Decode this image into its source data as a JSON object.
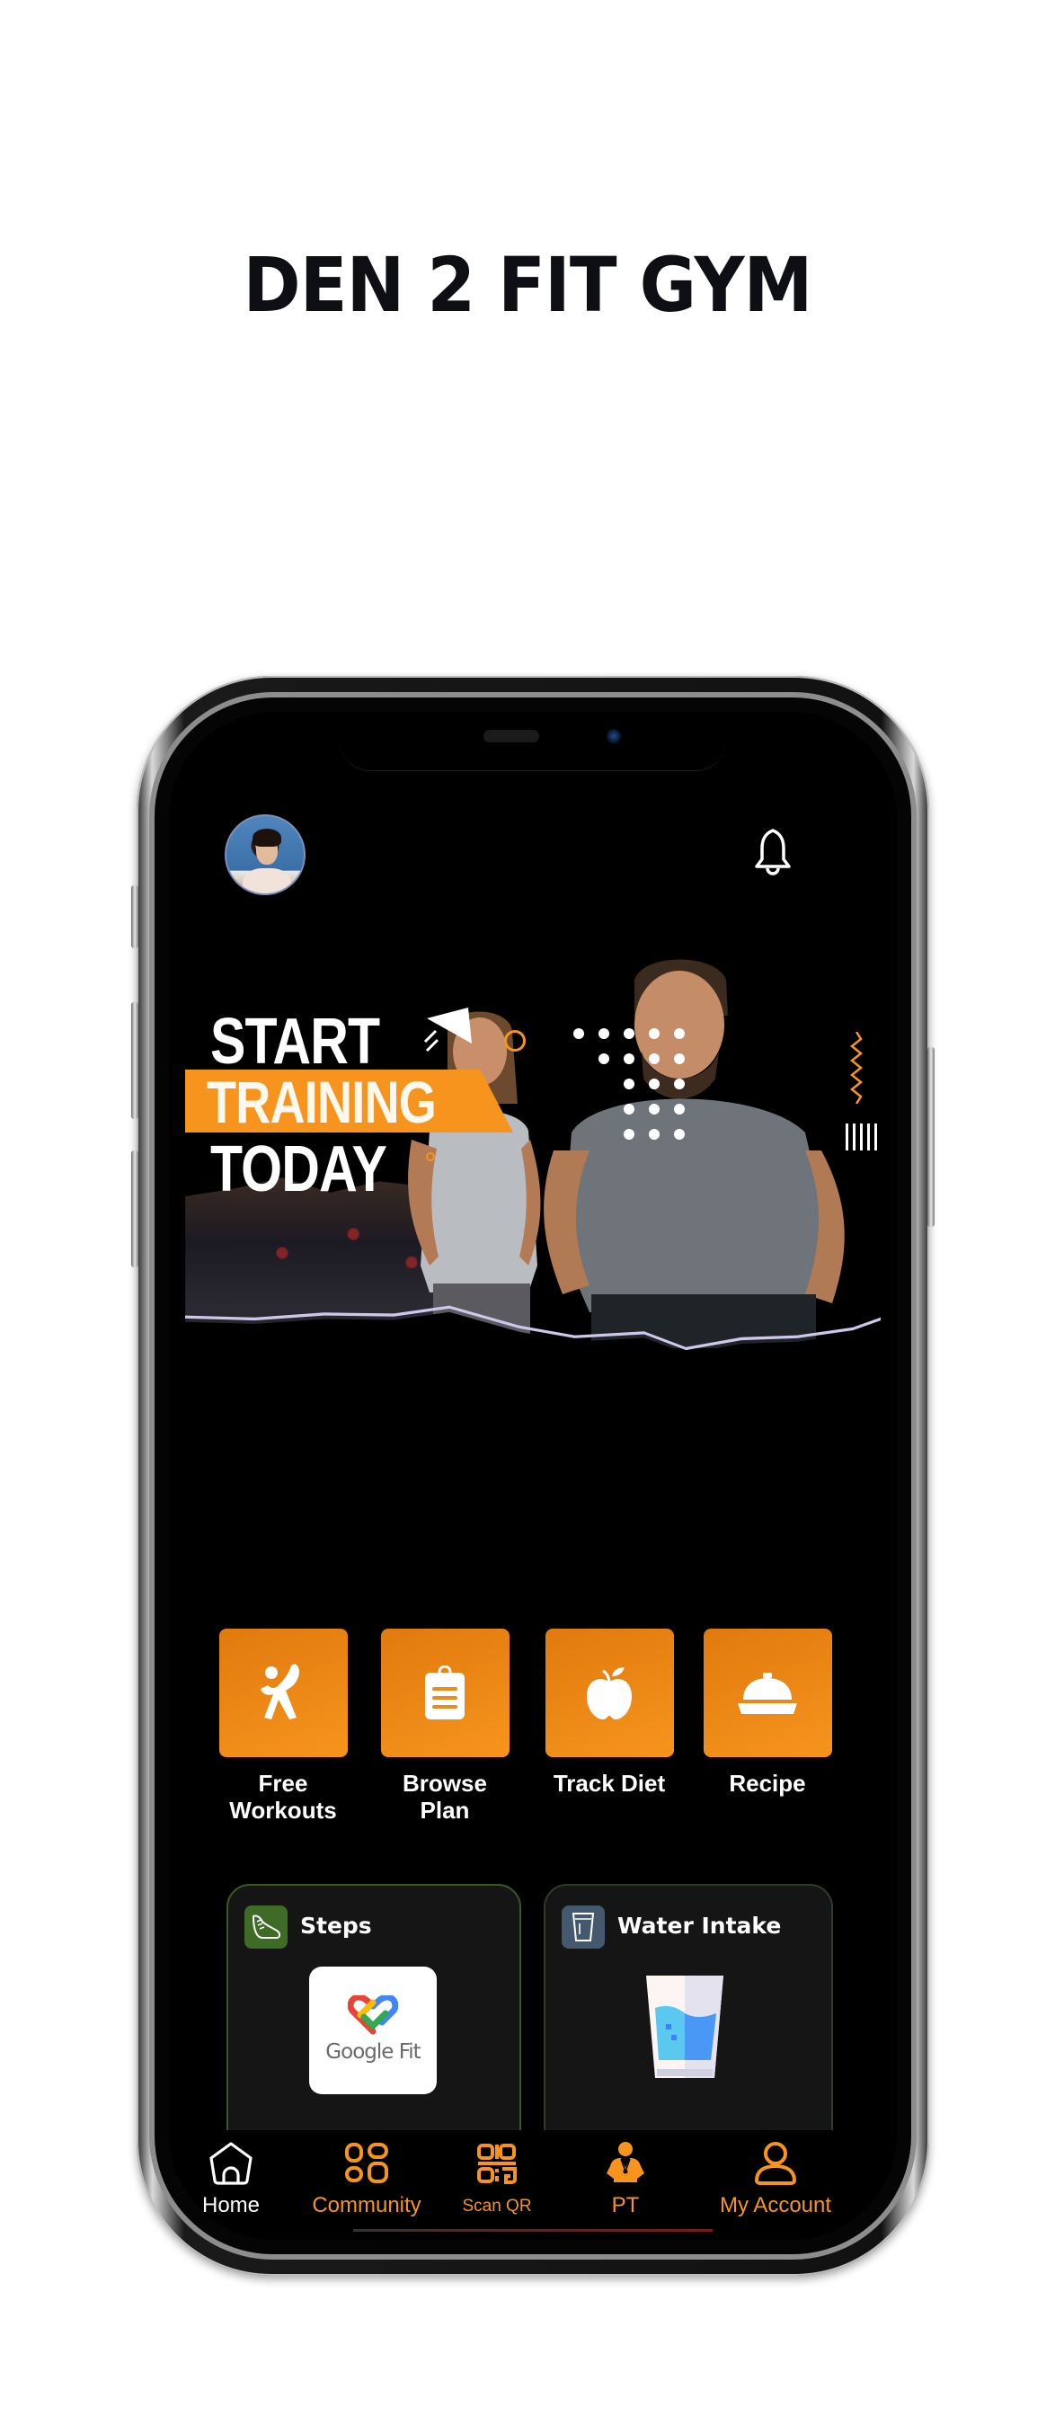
{
  "page": {
    "title": "DEN 2 FIT GYM"
  },
  "header": {
    "avatar_alt": "user-avatar",
    "notification_icon": "bell-icon"
  },
  "banner": {
    "line1": "START",
    "line2": "TRAINING",
    "line3": "TODAY",
    "accent_color": "#f7941d"
  },
  "quick_actions": [
    {
      "label_line1": "Free",
      "label_line2": "Workouts",
      "icon": "exercise-figure-icon"
    },
    {
      "label_line1": "Browse",
      "label_line2": "Plan",
      "icon": "clipboard-icon"
    },
    {
      "label_line1": "Track Diet",
      "label_line2": "",
      "icon": "apple-icon"
    },
    {
      "label_line1": "Recipe",
      "label_line2": "",
      "icon": "cloche-icon"
    }
  ],
  "cards": {
    "steps": {
      "title": "Steps",
      "icon": "shoe-icon",
      "provider": "Google Fit",
      "chip_color": "#3e6b25"
    },
    "water": {
      "title": "Water Intake",
      "icon": "glass-icon",
      "chip_color": "#44596d"
    }
  },
  "bottom_nav": {
    "items": [
      {
        "label": "Home",
        "icon": "home-icon",
        "active": true
      },
      {
        "label": "Community",
        "icon": "community-grid-icon",
        "active": false
      },
      {
        "label": "Scan QR",
        "icon": "qr-code-icon",
        "active": false
      },
      {
        "label": "PT",
        "icon": "personal-trainer-icon",
        "active": false
      },
      {
        "label": "My Account",
        "icon": "user-icon",
        "active": false
      }
    ],
    "active_color": "#ffffff",
    "inactive_color": "#f7941d"
  }
}
